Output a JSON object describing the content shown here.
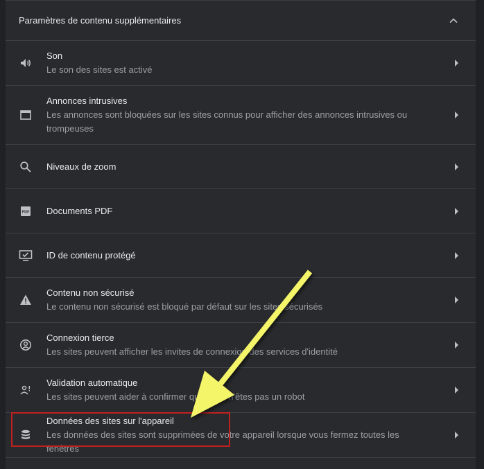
{
  "header": {
    "title": "Paramètres de contenu supplémentaires"
  },
  "rows": [
    {
      "title": "Son",
      "subtitle": "Le son des sites est activé",
      "icon": "speaker-icon"
    },
    {
      "title": "Annonces intrusives",
      "subtitle": "Les annonces sont bloquées sur les sites connus pour afficher des annonces intrusives ou trompeuses",
      "icon": "window-icon"
    },
    {
      "title": "Niveaux de zoom",
      "subtitle": "",
      "icon": "search-icon"
    },
    {
      "title": "Documents PDF",
      "subtitle": "",
      "icon": "pdf-icon"
    },
    {
      "title": "ID de contenu protégé",
      "subtitle": "",
      "icon": "protected-content-icon"
    },
    {
      "title": "Contenu non sécurisé",
      "subtitle": "Le contenu non sécurisé est bloqué par défaut sur les sites sécurisés",
      "icon": "warning-icon"
    },
    {
      "title": "Connexion tierce",
      "subtitle": "Les sites peuvent afficher les invites de connexion des services d'identité",
      "icon": "account-circle-icon"
    },
    {
      "title": "Validation automatique",
      "subtitle": "Les sites peuvent aider à confirmer que vous n'êtes pas un robot",
      "icon": "person-check-icon"
    },
    {
      "title": "Données des sites sur l'appareil",
      "subtitle": "Les données des sites sont supprimées de votre appareil lorsque vous fermez toutes les fenêtres",
      "icon": "database-icon"
    }
  ],
  "colors": {
    "background": "#202124",
    "card": "#292a2d",
    "divider": "#3c4043",
    "text_primary": "#e8eaed",
    "text_secondary": "#9aa0a6",
    "highlight_border": "#c0211f",
    "annotation_arrow": "#f5f56b"
  }
}
